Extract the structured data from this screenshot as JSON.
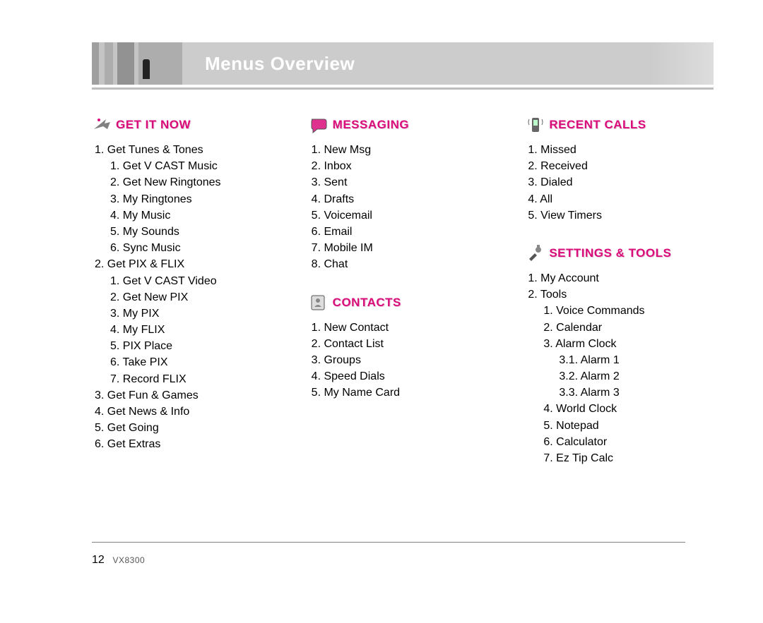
{
  "header": {
    "title": "Menus Overview"
  },
  "footer": {
    "page": "12",
    "model": "VX8300"
  },
  "col1": {
    "s1": {
      "title": "GET IT NOW",
      "items": [
        {
          "n": "1.",
          "t": "Get Tunes & Tones",
          "sub": [
            {
              "n": "1.",
              "t": "Get V CAST Music"
            },
            {
              "n": "2.",
              "t": "Get New Ringtones"
            },
            {
              "n": "3.",
              "t": "My Ringtones"
            },
            {
              "n": "4.",
              "t": "My Music"
            },
            {
              "n": "5.",
              "t": "My Sounds"
            },
            {
              "n": "6.",
              "t": "Sync Music"
            }
          ]
        },
        {
          "n": "2.",
          "t": "Get PIX & FLIX",
          "sub": [
            {
              "n": "1.",
              "t": "Get V CAST Video"
            },
            {
              "n": "2.",
              "t": "Get New PIX"
            },
            {
              "n": "3.",
              "t": "My PIX"
            },
            {
              "n": "4.",
              "t": "My FLIX"
            },
            {
              "n": "5.",
              "t": "PIX Place"
            },
            {
              "n": "6.",
              "t": "Take PIX"
            },
            {
              "n": "7.",
              "t": "Record FLIX"
            }
          ]
        },
        {
          "n": "3.",
          "t": "Get Fun & Games"
        },
        {
          "n": "4.",
          "t": "Get News & Info"
        },
        {
          "n": "5.",
          "t": "Get Going"
        },
        {
          "n": "6.",
          "t": "Get Extras"
        }
      ]
    }
  },
  "col2": {
    "s1": {
      "title": "MESSAGING",
      "items": [
        {
          "n": "1.",
          "t": "New Msg"
        },
        {
          "n": "2.",
          "t": "Inbox"
        },
        {
          "n": "3.",
          "t": "Sent"
        },
        {
          "n": "4.",
          "t": "Drafts"
        },
        {
          "n": "5.",
          "t": "Voicemail"
        },
        {
          "n": "6.",
          "t": "Email"
        },
        {
          "n": "7.",
          "t": "Mobile IM"
        },
        {
          "n": "8.",
          "t": "Chat"
        }
      ]
    },
    "s2": {
      "title": "CONTACTS",
      "items": [
        {
          "n": "1.",
          "t": "New Contact"
        },
        {
          "n": "2.",
          "t": "Contact List"
        },
        {
          "n": "3.",
          "t": "Groups"
        },
        {
          "n": "4.",
          "t": "Speed Dials"
        },
        {
          "n": "5.",
          "t": "My Name Card"
        }
      ]
    }
  },
  "col3": {
    "s1": {
      "title": "RECENT CALLS",
      "items": [
        {
          "n": "1.",
          "t": "Missed"
        },
        {
          "n": "2.",
          "t": "Received"
        },
        {
          "n": "3.",
          "t": "Dialed"
        },
        {
          "n": "4.",
          "t": "All"
        },
        {
          "n": "5.",
          "t": "View Timers"
        }
      ]
    },
    "s2": {
      "title": "SETTINGS & TOOLS",
      "items": [
        {
          "n": "1.",
          "t": "My Account"
        },
        {
          "n": "2.",
          "t": "Tools",
          "sub": [
            {
              "n": "1.",
              "t": "Voice Commands"
            },
            {
              "n": "2.",
              "t": "Calendar"
            },
            {
              "n": "3.",
              "t": "Alarm Clock",
              "sub": [
                {
                  "n": "3.1.",
                  "t": "Alarm 1"
                },
                {
                  "n": "3.2.",
                  "t": "Alarm 2"
                },
                {
                  "n": "3.3.",
                  "t": "Alarm 3"
                }
              ]
            },
            {
              "n": "4.",
              "t": "World Clock"
            },
            {
              "n": "5.",
              "t": "Notepad"
            },
            {
              "n": "6.",
              "t": "Calculator"
            },
            {
              "n": "7.",
              "t": "Ez Tip Calc"
            }
          ]
        }
      ]
    }
  }
}
